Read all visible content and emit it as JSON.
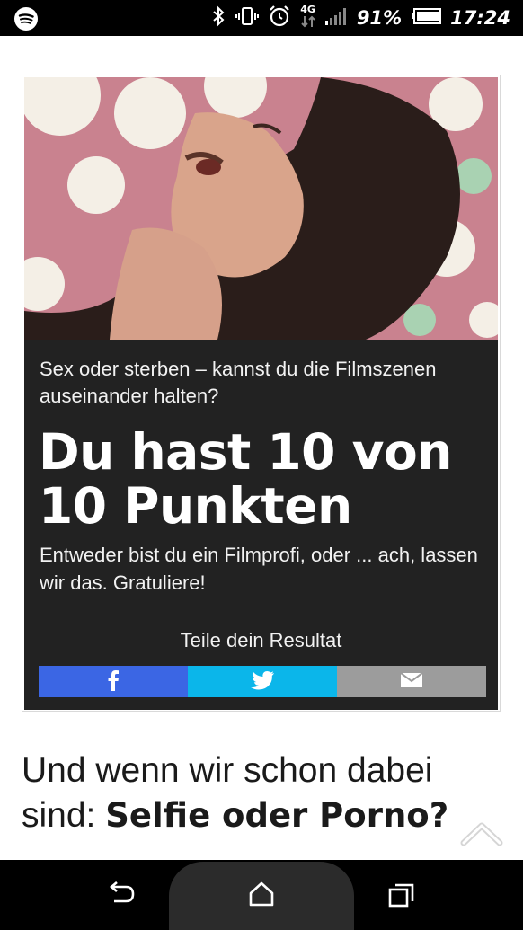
{
  "status_bar": {
    "network": "4G",
    "battery": "91%",
    "time": "17:24"
  },
  "article": {
    "question": "Sex oder sterben – kannst du die Filmszenen auseinander halten?",
    "score": "Du hast 10 von 10 Punkten",
    "comment": "Entweder bist du ein Filmprofi, oder ... ach, lassen wir das. Gratuliere!",
    "share_label": "Teile dein Resultat",
    "share_buttons": [
      {
        "icon": "facebook-icon",
        "color": "#3b66e4"
      },
      {
        "icon": "twitter-icon",
        "color": "#0bb6ea"
      },
      {
        "icon": "mail-icon",
        "color": "#9c9c9c"
      }
    ]
  },
  "teaser": {
    "prefix": "Und wenn wir schon dabei sind: ",
    "highlight": "Selfie oder Porno?"
  },
  "colors": {
    "card_background": "#222222",
    "facebook": "#3b66e4",
    "twitter": "#0bb6ea",
    "mail": "#9c9c9c"
  },
  "nav_bar": {
    "buttons": [
      "back-icon",
      "home-icon",
      "recents-icon"
    ]
  }
}
